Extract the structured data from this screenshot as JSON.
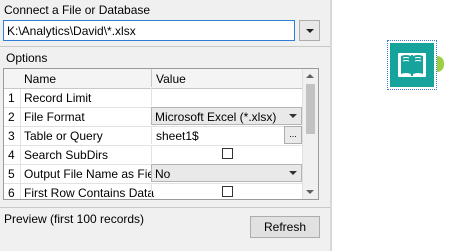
{
  "connect": {
    "label": "Connect a File or Database",
    "path_value": "K:\\Analytics\\David\\*.xlsx"
  },
  "options": {
    "label": "Options",
    "header": {
      "name": "Name",
      "value": "Value"
    },
    "rows": [
      {
        "num": "1",
        "name": "Record Limit",
        "value": ""
      },
      {
        "num": "2",
        "name": "File Format",
        "value": "Microsoft Excel (*.xlsx)"
      },
      {
        "num": "3",
        "name": "Table or Query",
        "value": "sheet1$",
        "button": "..."
      },
      {
        "num": "4",
        "name": "Search SubDirs",
        "checked": false
      },
      {
        "num": "5",
        "name": "Output File Name as Field",
        "value": "No"
      },
      {
        "num": "6",
        "name": "First Row Contains Data",
        "checked": false
      }
    ]
  },
  "preview": {
    "label": "Preview (first 100 records)",
    "refresh_label": "Refresh"
  },
  "canvas": {
    "tool_icon": "input-data-book-icon",
    "tool_color": "#16a39c",
    "anchor_color": "#9ccf42"
  }
}
